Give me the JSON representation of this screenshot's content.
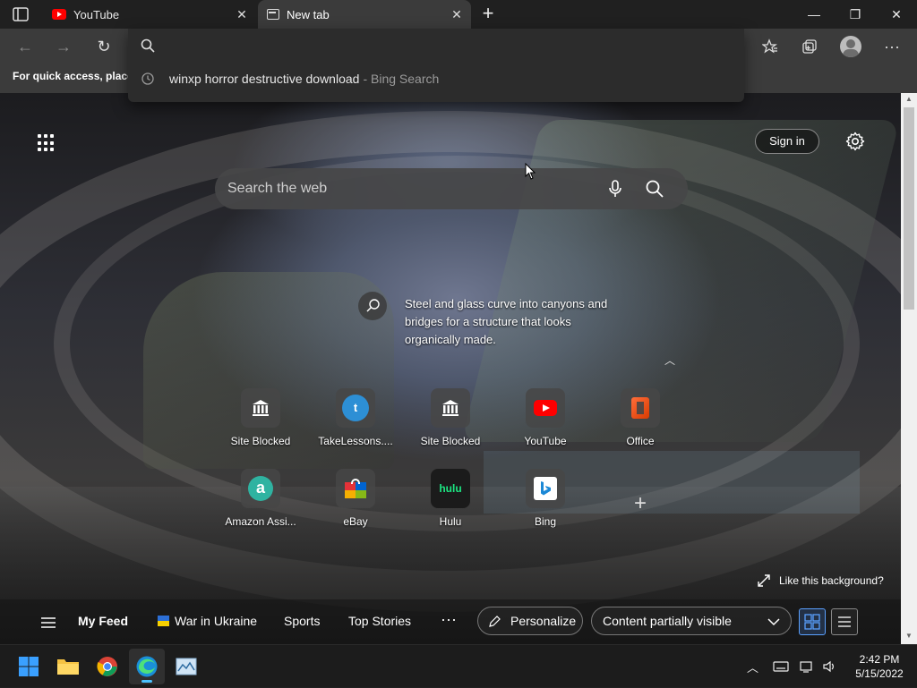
{
  "tabs": [
    {
      "label": "YouTube"
    },
    {
      "label": "New tab"
    }
  ],
  "favorites_bar": {
    "text": "For quick access, place y"
  },
  "omnibox": {
    "input_value": "",
    "suggestion": {
      "query": "winxp horror destructive download",
      "source": "- Bing Search"
    }
  },
  "newtab": {
    "sign_in": "Sign in",
    "search_placeholder": "Search the web",
    "caption": "Steel and glass curve into canyons and bridges for a structure that looks organically made.",
    "like_background": "Like this background?",
    "tiles": [
      {
        "name": "Site Blocked",
        "icon": "site-blocked-icon"
      },
      {
        "name": "TakeLessons....",
        "icon": "takelessons-icon"
      },
      {
        "name": "Site Blocked",
        "icon": "site-blocked-icon"
      },
      {
        "name": "YouTube",
        "icon": "youtube-icon"
      },
      {
        "name": "Office",
        "icon": "office-icon"
      },
      {
        "name": "Amazon Assi...",
        "icon": "amazon-assistant-icon"
      },
      {
        "name": "eBay",
        "icon": "ebay-icon"
      },
      {
        "name": "Hulu",
        "icon": "hulu-icon"
      },
      {
        "name": "Bing",
        "icon": "bing-icon"
      }
    ]
  },
  "feed": {
    "my_feed": "My Feed",
    "war_in_ukraine": "War in Ukraine",
    "sports": "Sports",
    "top_stories": "Top Stories",
    "more": "···",
    "personalize": "Personalize",
    "content_visibility": "Content partially visible"
  },
  "taskbar": {
    "time": "2:42 PM",
    "date": "5/15/2022"
  },
  "colors": {
    "accent": "#4cc2ff",
    "youtube_red": "#ff0000",
    "office_orange": "#e64a19",
    "amazon_teal": "#2fb3a1"
  }
}
